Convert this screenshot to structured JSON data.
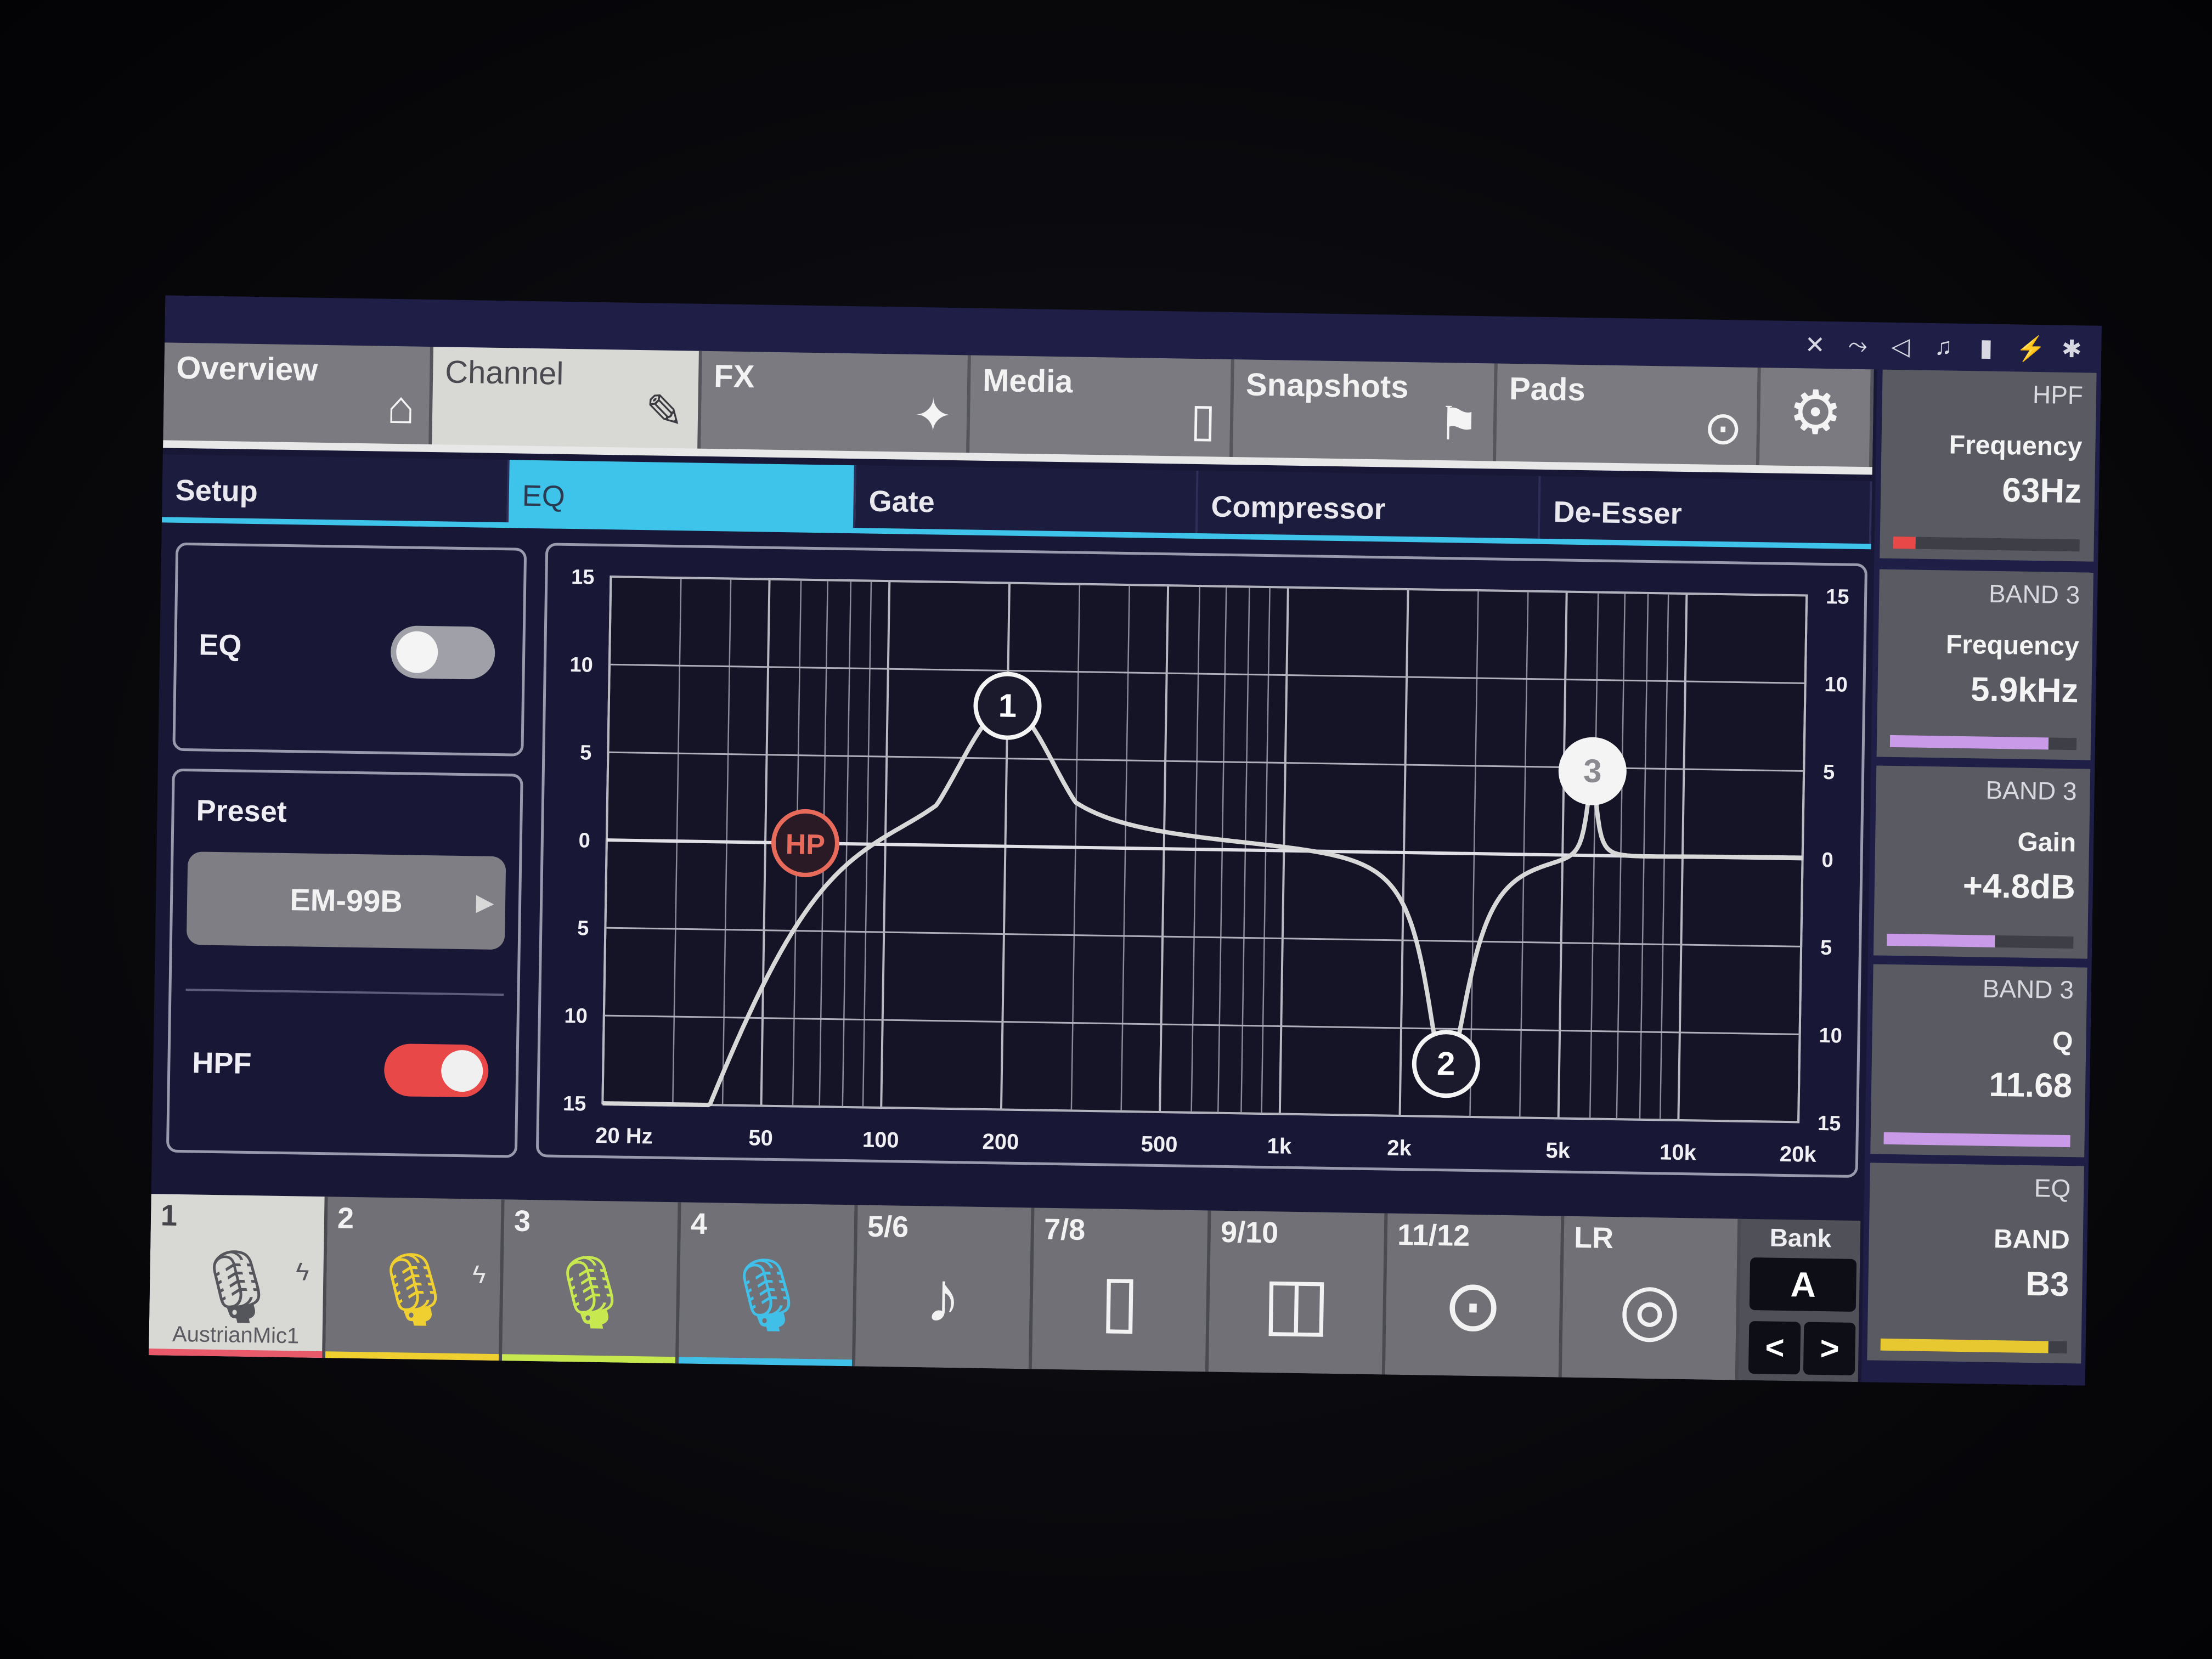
{
  "status_icons": [
    "✕",
    "⤳",
    "◁",
    "♫",
    "▮",
    "⚡",
    "✱"
  ],
  "top_tabs": [
    {
      "label": "Overview",
      "icon": "home-icon",
      "glyph": "⌂"
    },
    {
      "label": "Channel",
      "icon": "pencil-icon",
      "glyph": "✎"
    },
    {
      "label": "FX",
      "icon": "sparkle-icon",
      "glyph": "✦"
    },
    {
      "label": "Media",
      "icon": "sd-card-icon",
      "glyph": "▯"
    },
    {
      "label": "Snapshots",
      "icon": "bookmark-icon",
      "glyph": "⚑"
    },
    {
      "label": "Pads",
      "icon": "pads-icon",
      "glyph": "⊙"
    },
    {
      "label": "",
      "icon": "gear-icon",
      "glyph": "⚙"
    }
  ],
  "active_top_tab": "Channel",
  "sub_tabs": [
    "Setup",
    "EQ",
    "Gate",
    "Compressor",
    "De-Esser"
  ],
  "active_sub_tab": "EQ",
  "eq_panel": {
    "label": "EQ",
    "enabled": false
  },
  "preset_panel": {
    "label": "Preset",
    "preset_name": "EM-99B",
    "arrow": "▶"
  },
  "hpf_panel": {
    "label": "HPF",
    "enabled": true
  },
  "graph": {
    "y_ticks": [
      "15",
      "10",
      "5",
      "0",
      "5",
      "10",
      "15"
    ],
    "x_ticks": [
      "20 Hz",
      "50",
      "100",
      "200",
      "500",
      "1k",
      "2k",
      "5k",
      "10k",
      "20k"
    ],
    "nodes": [
      {
        "label": "HP",
        "freq_hz": 63,
        "gain_db": 0
      },
      {
        "label": "1",
        "freq_hz": 200,
        "gain_db": 8
      },
      {
        "label": "2",
        "freq_hz": 2600,
        "gain_db": -12
      },
      {
        "label": "3",
        "freq_hz": 5900,
        "gain_db": 4.8
      }
    ],
    "line_color": "#d8d8d8",
    "hp_color": "#e86a5a"
  },
  "right_panel": [
    {
      "t1": "HPF",
      "t2": "Frequency",
      "t3": "63Hz",
      "bar_level": 0.12,
      "bar_color": "#e84848"
    },
    {
      "t1": "BAND 3",
      "t2": "Frequency",
      "t3": "5.9kHz",
      "bar_level": 0.85,
      "bar_color": "#c89ae8"
    },
    {
      "t1": "BAND 3",
      "t2": "Gain",
      "t3": "+4.8dB",
      "bar_level": 0.58,
      "bar_color": "#c89ae8"
    },
    {
      "t1": "BAND 3",
      "t2": "Q",
      "t3": "11.68",
      "bar_level": 1.0,
      "bar_color": "#c89ae8"
    },
    {
      "t1": "EQ",
      "t2": "BAND",
      "t3": "B3",
      "bar_level": 0.9,
      "bar_color": "#e8c830"
    }
  ],
  "channels": [
    {
      "num": "1",
      "icon": "microphone-icon",
      "glyph": "🎙",
      "color": "#f2f2f2",
      "name": "AustrianMic1",
      "bolt": "ϟ",
      "bar": "#e85a6a"
    },
    {
      "num": "2",
      "icon": "microphone-icon",
      "glyph": "🎙",
      "color": "#f0d030",
      "name": "",
      "bolt": "ϟ",
      "bar": "#f0d030"
    },
    {
      "num": "3",
      "icon": "microphone-icon",
      "glyph": "🎙",
      "color": "#c8e850",
      "name": "",
      "bolt": "",
      "bar": "#c8e850"
    },
    {
      "num": "4",
      "icon": "microphone-icon",
      "glyph": "🎙",
      "color": "#40c0e8",
      "name": "",
      "bolt": "",
      "bar": "#40c0e8"
    },
    {
      "num": "5/6",
      "icon": "music-note-icon",
      "glyph": "♪",
      "color": "#f2f2f2",
      "name": "",
      "bolt": "",
      "bar": ""
    },
    {
      "num": "7/8",
      "icon": "phone-icon",
      "glyph": "▯",
      "color": "#f2f2f2",
      "name": "",
      "bolt": "",
      "bar": ""
    },
    {
      "num": "9/10",
      "icon": "cast-icon",
      "glyph": "◫",
      "color": "#f2f2f2",
      "name": "",
      "bolt": "",
      "bar": ""
    },
    {
      "num": "11/12",
      "icon": "pads-icon",
      "glyph": "⊙",
      "color": "#f2f2f2",
      "name": "",
      "bolt": "",
      "bar": ""
    },
    {
      "num": "LR",
      "icon": "speaker-icon",
      "glyph": "◎",
      "color": "#f2f2f2",
      "name": "",
      "bolt": "",
      "bar": ""
    }
  ],
  "bank": {
    "label": "Bank",
    "value": "A",
    "prev": "<",
    "next": ">"
  }
}
